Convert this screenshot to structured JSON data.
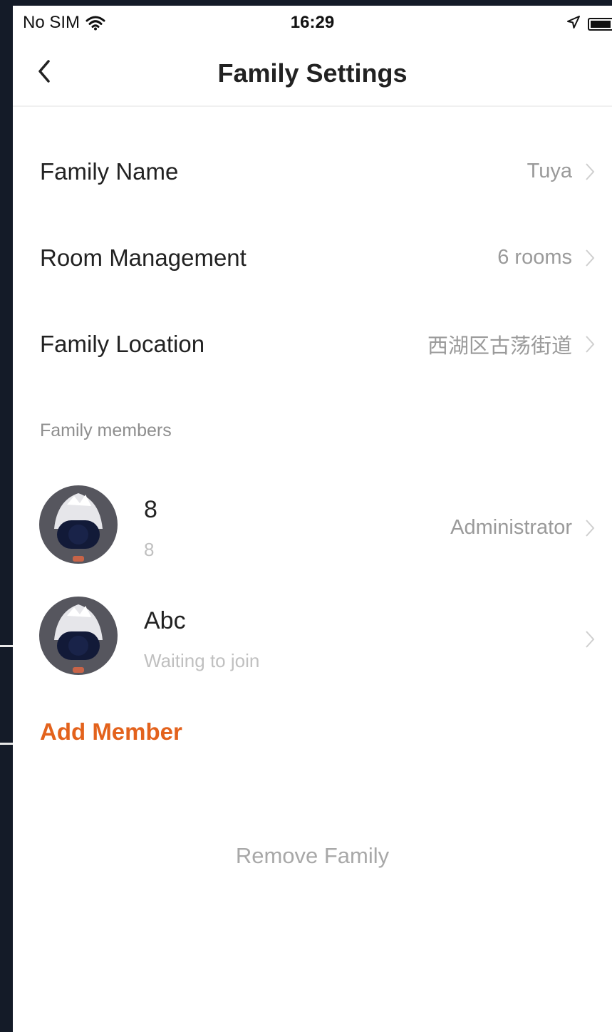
{
  "status_bar": {
    "carrier": "No SIM",
    "time": "16:29",
    "wifi_icon": "wifi-icon",
    "location_icon": "location-arrow-icon",
    "battery_icon": "battery-icon"
  },
  "nav": {
    "back_icon": "chevron-left-icon",
    "title": "Family Settings"
  },
  "settings": {
    "family_name": {
      "label": "Family Name",
      "value": "Tuya"
    },
    "room_management": {
      "label": "Room Management",
      "value": "6 rooms"
    },
    "family_location": {
      "label": "Family Location",
      "value": "西湖区古荡街道"
    }
  },
  "members_section": {
    "header": "Family members",
    "members": [
      {
        "name": "8",
        "sub": "8",
        "role": "Administrator"
      },
      {
        "name": "Abc",
        "sub": "Waiting to join",
        "role": ""
      }
    ],
    "add_label": "Add Member"
  },
  "footer": {
    "remove_label": "Remove Family"
  },
  "colors": {
    "accent": "#e3621c",
    "frame": "#141b28",
    "secondary_text": "#9a9a9a"
  }
}
